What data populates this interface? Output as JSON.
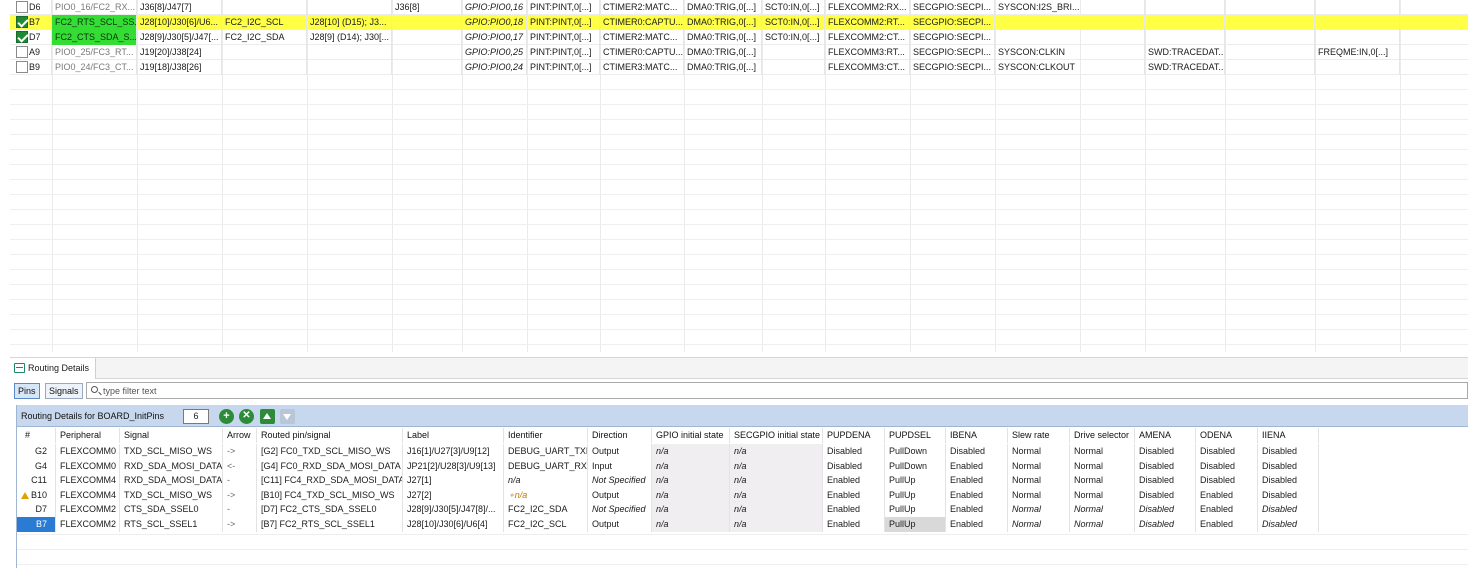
{
  "pins": {
    "rows": [
      {
        "checked": false,
        "highlighted": false,
        "cells": [
          "D6",
          "PIO0_16/FC2_RX...",
          "J36[8]/J47[7]",
          "",
          "",
          "J36[8]",
          "GPIO:PIO0,16",
          "PINT:PINT,0[...]",
          "CTIMER2:MATC...",
          "DMA0:TRIG,0[...]",
          "SCT0:IN,0[...]",
          "FLEXCOMM2:RX...",
          "SECGPIO:SECPI...",
          "SYSCON:I2S_BRI...",
          "",
          "",
          "",
          ""
        ]
      },
      {
        "checked": true,
        "highlighted": true,
        "cells": [
          "B7",
          "FC2_RTS_SCL_SS...",
          "J28[10]/J30[6]/U6...",
          "FC2_I2C_SCL",
          "J28[10] (D15); J3...",
          "",
          "GPIO:PIO0,18",
          "PINT:PINT,0[...]",
          "CTIMER0:CAPTU...",
          "DMA0:TRIG,0[...]",
          "SCT0:IN,0[...]",
          "FLEXCOMM2:RT...",
          "SECGPIO:SECPI...",
          "",
          "",
          "",
          "",
          ""
        ]
      },
      {
        "checked": true,
        "highlighted": false,
        "cells": [
          "D7",
          "FC2_CTS_SDA_S...",
          "J28[9]/J30[5]/J47[...",
          "FC2_I2C_SDA",
          "J28[9] (D14); J30[...",
          "",
          "GPIO:PIO0,17",
          "PINT:PINT,0[...]",
          "CTIMER2:MATC...",
          "DMA0:TRIG,0[...]",
          "SCT0:IN,0[...]",
          "FLEXCOMM2:CT...",
          "SECGPIO:SECPI...",
          "",
          "",
          "",
          "",
          ""
        ]
      },
      {
        "checked": false,
        "highlighted": false,
        "cells": [
          "A9",
          "PIO0_25/FC3_RT...",
          "J19[20]/J38[24]",
          "",
          "",
          "",
          "GPIO:PIO0,25",
          "PINT:PINT,0[...]",
          "CTIMER0:CAPTU...",
          "DMA0:TRIG,0[...]",
          "",
          "FLEXCOMM3:RT...",
          "SECGPIO:SECPI...",
          "SYSCON:CLKIN",
          "",
          "SWD:TRACEDAT...",
          "",
          "FREQME:IN,0[...]"
        ]
      },
      {
        "checked": false,
        "highlighted": false,
        "cells": [
          "B9",
          "PIO0_24/FC3_CT...",
          "J19[18]/J38[26]",
          "",
          "",
          "",
          "GPIO:PIO0,24",
          "PINT:PINT,0[...]",
          "CTIMER3:MATC...",
          "DMA0:TRIG,0[...]",
          "",
          "FLEXCOMM3:CT...",
          "SECGPIO:SECPI...",
          "SYSCON:CLKOUT",
          "",
          "SWD:TRACEDAT...",
          "",
          ""
        ]
      }
    ]
  },
  "routing": {
    "tab_label": "Routing Details",
    "pins_button": "Pins",
    "signals_button": "Signals",
    "filter_placeholder": "type filter text",
    "title": "Routing Details for BOARD_InitPins",
    "count": "6",
    "columns": [
      "#",
      "Peripheral",
      "Signal",
      "Arrow",
      "Routed pin/signal",
      "Label",
      "Identifier",
      "Direction",
      "GPIO initial state",
      "SECGPIO initial state",
      "PUPDENA",
      "PUPDSEL",
      "IBENA",
      "Slew rate",
      "Drive selector",
      "AMENA",
      "ODENA",
      "IIENA"
    ],
    "rows": [
      {
        "warn": false,
        "selected": false,
        "cells": [
          "G2",
          "FLEXCOMM0",
          "TXD_SCL_MISO_WS",
          "->",
          "[G2] FC0_TXD_SCL_MISO_WS",
          "J16[1]/U27[3]/U9[12]",
          "DEBUG_UART_TXD",
          "Output",
          "n/a",
          "n/a",
          "Disabled",
          "PullDown",
          "Disabled",
          "Normal",
          "Normal",
          "Disabled",
          "Disabled",
          "Disabled"
        ]
      },
      {
        "warn": false,
        "selected": false,
        "cells": [
          "G4",
          "FLEXCOMM0",
          "RXD_SDA_MOSI_DATA",
          "<-",
          "[G4] FC0_RXD_SDA_MOSI_DATA",
          "JP21[2]/U28[3]/U9[13]",
          "DEBUG_UART_RXD",
          "Input",
          "n/a",
          "n/a",
          "Disabled",
          "PullDown",
          "Enabled",
          "Normal",
          "Normal",
          "Disabled",
          "Disabled",
          "Disabled"
        ]
      },
      {
        "warn": false,
        "selected": false,
        "cells": [
          "C11",
          "FLEXCOMM4",
          "RXD_SDA_MOSI_DATA",
          "-",
          "[C11] FC4_RXD_SDA_MOSI_DATA",
          "J27[1]",
          "n/a",
          "Not Specified",
          "n/a",
          "n/a",
          "Enabled",
          "PullUp",
          "Enabled",
          "Normal",
          "Normal",
          "Disabled",
          "Disabled",
          "Disabled"
        ]
      },
      {
        "warn": true,
        "selected": false,
        "cells": [
          "B10",
          "FLEXCOMM4",
          "TXD_SCL_MISO_WS",
          "->",
          "[B10] FC4_TXD_SCL_MISO_WS",
          "J27[2]",
          "n/a",
          "Output",
          "n/a",
          "n/a",
          "Enabled",
          "PullUp",
          "Enabled",
          "Normal",
          "Normal",
          "Disabled",
          "Enabled",
          "Disabled"
        ]
      },
      {
        "warn": false,
        "selected": false,
        "cells": [
          "D7",
          "FLEXCOMM2",
          "CTS_SDA_SSEL0",
          "-",
          "[D7] FC2_CTS_SDA_SSEL0",
          "J28[9]/J30[5]/J47[8]/...",
          "FC2_I2C_SDA",
          "Not Specified",
          "n/a",
          "n/a",
          "Enabled",
          "PullUp",
          "Enabled",
          "Normal",
          "Normal",
          "Disabled",
          "Enabled",
          "Disabled"
        ]
      },
      {
        "warn": false,
        "selected": true,
        "cells": [
          "B7",
          "FLEXCOMM2",
          "RTS_SCL_SSEL1",
          "->",
          "[B7] FC2_RTS_SCL_SSEL1",
          "J28[10]/J30[6]/U6[4]",
          "FC2_I2C_SCL",
          "Output",
          "n/a",
          "n/a",
          "Enabled",
          "PullUp",
          "Enabled",
          "Normal",
          "Normal",
          "Disabled",
          "Enabled",
          "Disabled"
        ]
      }
    ]
  },
  "colors": {
    "highlight_row": "#ffff45",
    "green_cell": "#33dd33",
    "selection_blue": "#2a7bd4",
    "header_blue": "#c7d8ee"
  }
}
